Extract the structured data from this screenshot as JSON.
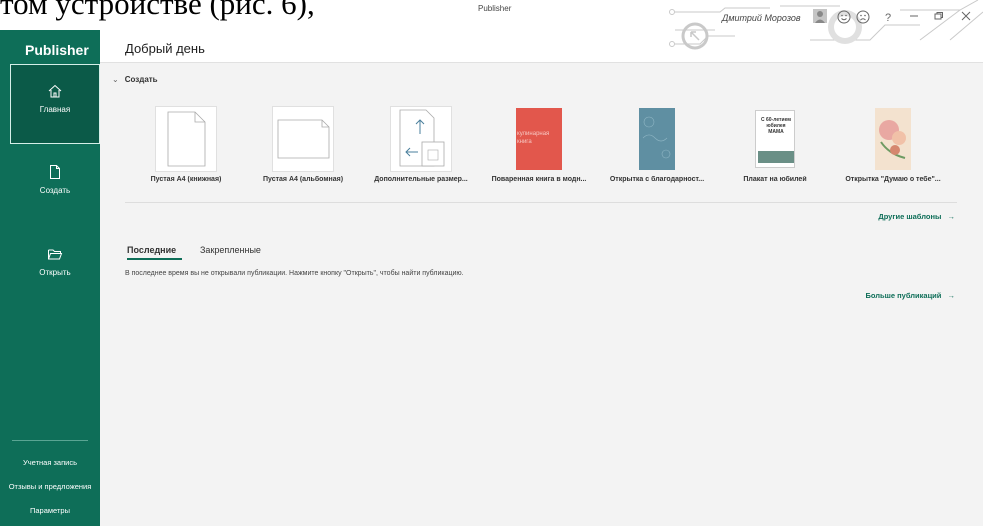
{
  "doc_snippet": "том устройстве (рис. 6),",
  "window": {
    "title": "Publisher",
    "user_name": "Дмитрий Морозов",
    "help": "?"
  },
  "sidebar": {
    "brand": "Publisher",
    "items": [
      {
        "label": "Главная",
        "icon": "home-icon"
      },
      {
        "label": "Создать",
        "icon": "new-file-icon"
      },
      {
        "label": "Открыть",
        "icon": "folder-open-icon"
      }
    ],
    "footer": [
      "Учетная запись",
      "Отзывы и предложения",
      "Параметры"
    ]
  },
  "main": {
    "greeting": "Добрый день",
    "create_heading": "Создать",
    "templates": [
      {
        "label": "Пустая A4 (книжная)"
      },
      {
        "label": "Пустая A4 (альбомная)"
      },
      {
        "label": "Дополнительные размер..."
      },
      {
        "label": "Поваренная книга в модн...",
        "cover_text": "кулинарная книга"
      },
      {
        "label": "Открытка с благодарност..."
      },
      {
        "label": "Плакат на юбилей",
        "cover_text": "С 60-летием юбилея МАМА"
      },
      {
        "label": "Открытка \"Думаю о тебе\"..."
      }
    ],
    "more_templates": "Другие шаблоны",
    "tabs": [
      "Последние",
      "Закрепленные"
    ],
    "empty_message": "В последнее время вы не открывали публикации. Нажмите кнопку \"Открыть\", чтобы найти публикацию.",
    "more_publications": "Больше публикаций"
  },
  "colors": {
    "sidebar": "#0e6e58",
    "accent": "#0e6e58",
    "cookbook_cover": "#e2574c",
    "card_cover": "#5f8fa2"
  }
}
